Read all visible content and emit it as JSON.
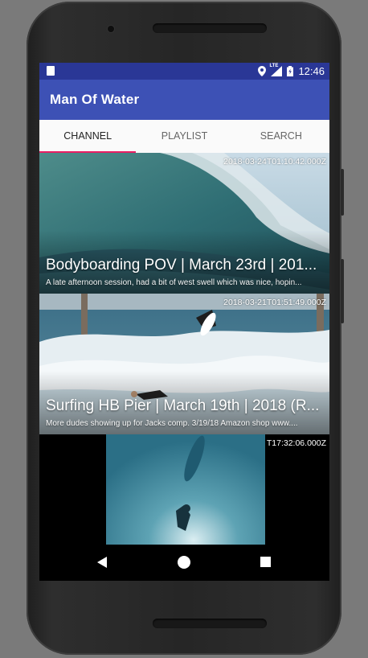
{
  "status_bar": {
    "time": "12:46",
    "lte": "LTE"
  },
  "app": {
    "title": "Man Of Water"
  },
  "tabs": [
    {
      "label": "CHANNEL",
      "active": true
    },
    {
      "label": "PLAYLIST",
      "active": false
    },
    {
      "label": "SEARCH",
      "active": false
    }
  ],
  "videos": [
    {
      "date": "2018-03-24T01:10:42.000Z",
      "title": "Bodyboarding POV | March 23rd | 201...",
      "description": "A late afternoon session, had a bit of west swell which was nice, hopin..."
    },
    {
      "date": "2018-03-21T01:51:49.000Z",
      "title": "Surfing HB Pier | March 19th | 2018 (R...",
      "description": "More dudes showing up for Jacks comp. 3/19/18 Amazon shop www...."
    },
    {
      "date": "T17:32:06.000Z",
      "title": "",
      "description": ""
    }
  ],
  "colors": {
    "status_bar": "#2a3796",
    "app_bar": "#3d51b5",
    "tab_indicator": "#e91e63"
  }
}
